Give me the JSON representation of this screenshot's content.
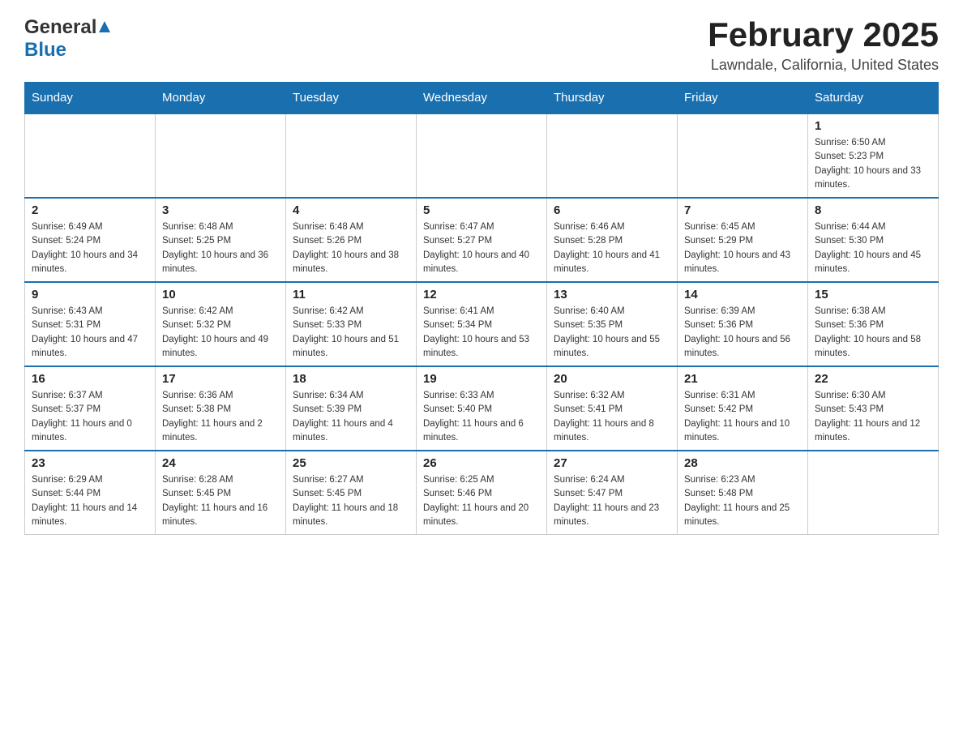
{
  "header": {
    "logo_general": "General",
    "logo_blue": "Blue",
    "title": "February 2025",
    "subtitle": "Lawndale, California, United States"
  },
  "calendar": {
    "days_of_week": [
      "Sunday",
      "Monday",
      "Tuesday",
      "Wednesday",
      "Thursday",
      "Friday",
      "Saturday"
    ],
    "weeks": [
      [
        {
          "day": "",
          "info": ""
        },
        {
          "day": "",
          "info": ""
        },
        {
          "day": "",
          "info": ""
        },
        {
          "day": "",
          "info": ""
        },
        {
          "day": "",
          "info": ""
        },
        {
          "day": "",
          "info": ""
        },
        {
          "day": "1",
          "info": "Sunrise: 6:50 AM\nSunset: 5:23 PM\nDaylight: 10 hours and 33 minutes."
        }
      ],
      [
        {
          "day": "2",
          "info": "Sunrise: 6:49 AM\nSunset: 5:24 PM\nDaylight: 10 hours and 34 minutes."
        },
        {
          "day": "3",
          "info": "Sunrise: 6:48 AM\nSunset: 5:25 PM\nDaylight: 10 hours and 36 minutes."
        },
        {
          "day": "4",
          "info": "Sunrise: 6:48 AM\nSunset: 5:26 PM\nDaylight: 10 hours and 38 minutes."
        },
        {
          "day": "5",
          "info": "Sunrise: 6:47 AM\nSunset: 5:27 PM\nDaylight: 10 hours and 40 minutes."
        },
        {
          "day": "6",
          "info": "Sunrise: 6:46 AM\nSunset: 5:28 PM\nDaylight: 10 hours and 41 minutes."
        },
        {
          "day": "7",
          "info": "Sunrise: 6:45 AM\nSunset: 5:29 PM\nDaylight: 10 hours and 43 minutes."
        },
        {
          "day": "8",
          "info": "Sunrise: 6:44 AM\nSunset: 5:30 PM\nDaylight: 10 hours and 45 minutes."
        }
      ],
      [
        {
          "day": "9",
          "info": "Sunrise: 6:43 AM\nSunset: 5:31 PM\nDaylight: 10 hours and 47 minutes."
        },
        {
          "day": "10",
          "info": "Sunrise: 6:42 AM\nSunset: 5:32 PM\nDaylight: 10 hours and 49 minutes."
        },
        {
          "day": "11",
          "info": "Sunrise: 6:42 AM\nSunset: 5:33 PM\nDaylight: 10 hours and 51 minutes."
        },
        {
          "day": "12",
          "info": "Sunrise: 6:41 AM\nSunset: 5:34 PM\nDaylight: 10 hours and 53 minutes."
        },
        {
          "day": "13",
          "info": "Sunrise: 6:40 AM\nSunset: 5:35 PM\nDaylight: 10 hours and 55 minutes."
        },
        {
          "day": "14",
          "info": "Sunrise: 6:39 AM\nSunset: 5:36 PM\nDaylight: 10 hours and 56 minutes."
        },
        {
          "day": "15",
          "info": "Sunrise: 6:38 AM\nSunset: 5:36 PM\nDaylight: 10 hours and 58 minutes."
        }
      ],
      [
        {
          "day": "16",
          "info": "Sunrise: 6:37 AM\nSunset: 5:37 PM\nDaylight: 11 hours and 0 minutes."
        },
        {
          "day": "17",
          "info": "Sunrise: 6:36 AM\nSunset: 5:38 PM\nDaylight: 11 hours and 2 minutes."
        },
        {
          "day": "18",
          "info": "Sunrise: 6:34 AM\nSunset: 5:39 PM\nDaylight: 11 hours and 4 minutes."
        },
        {
          "day": "19",
          "info": "Sunrise: 6:33 AM\nSunset: 5:40 PM\nDaylight: 11 hours and 6 minutes."
        },
        {
          "day": "20",
          "info": "Sunrise: 6:32 AM\nSunset: 5:41 PM\nDaylight: 11 hours and 8 minutes."
        },
        {
          "day": "21",
          "info": "Sunrise: 6:31 AM\nSunset: 5:42 PM\nDaylight: 11 hours and 10 minutes."
        },
        {
          "day": "22",
          "info": "Sunrise: 6:30 AM\nSunset: 5:43 PM\nDaylight: 11 hours and 12 minutes."
        }
      ],
      [
        {
          "day": "23",
          "info": "Sunrise: 6:29 AM\nSunset: 5:44 PM\nDaylight: 11 hours and 14 minutes."
        },
        {
          "day": "24",
          "info": "Sunrise: 6:28 AM\nSunset: 5:45 PM\nDaylight: 11 hours and 16 minutes."
        },
        {
          "day": "25",
          "info": "Sunrise: 6:27 AM\nSunset: 5:45 PM\nDaylight: 11 hours and 18 minutes."
        },
        {
          "day": "26",
          "info": "Sunrise: 6:25 AM\nSunset: 5:46 PM\nDaylight: 11 hours and 20 minutes."
        },
        {
          "day": "27",
          "info": "Sunrise: 6:24 AM\nSunset: 5:47 PM\nDaylight: 11 hours and 23 minutes."
        },
        {
          "day": "28",
          "info": "Sunrise: 6:23 AM\nSunset: 5:48 PM\nDaylight: 11 hours and 25 minutes."
        },
        {
          "day": "",
          "info": ""
        }
      ]
    ]
  }
}
